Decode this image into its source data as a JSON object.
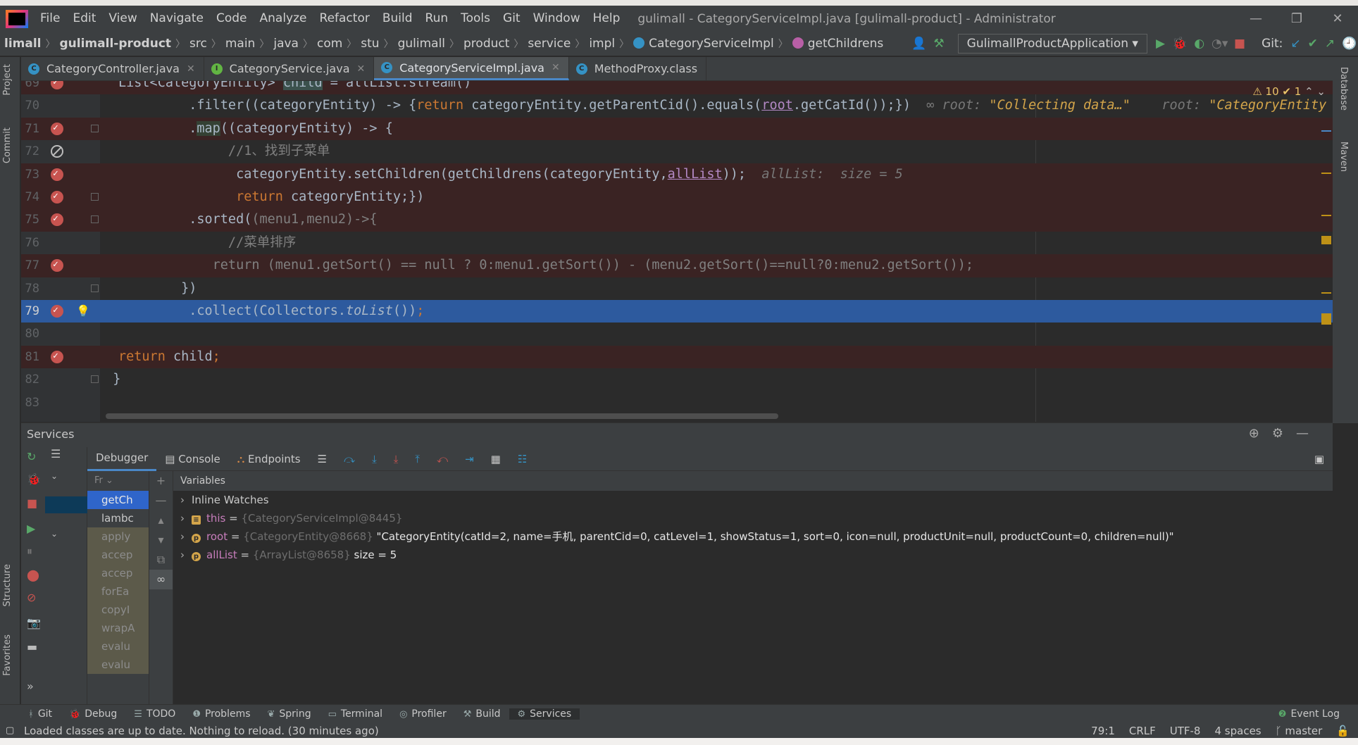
{
  "window": {
    "title": "gulimall - CategoryServiceImpl.java [gulimall-product] - Administrator",
    "menu": [
      "File",
      "Edit",
      "View",
      "Navigate",
      "Code",
      "Analyze",
      "Refactor",
      "Build",
      "Run",
      "Tools",
      "Git",
      "Window",
      "Help"
    ]
  },
  "breadcrumb": [
    "limall",
    "gulimall-product",
    "src",
    "main",
    "java",
    "com",
    "stu",
    "gulimall",
    "product",
    "service",
    "impl",
    "CategoryServiceImpl",
    "getChildrens"
  ],
  "run_config": "GulimallProductApplication",
  "git_label": "Git:",
  "tabs": [
    {
      "label": "CategoryController.java",
      "active": false,
      "color": "#3592c4",
      "letter": "C"
    },
    {
      "label": "CategoryService.java",
      "active": false,
      "color": "#62b543",
      "letter": "I"
    },
    {
      "label": "CategoryServiceImpl.java",
      "active": true,
      "color": "#3592c4",
      "letter": "C"
    },
    {
      "label": "MethodProxy.class",
      "active": false,
      "color": "#3592c4",
      "letter": "C"
    }
  ],
  "editor": {
    "warnings": "⚠ 10  ✔ 1",
    "lines": [
      {
        "n": "69",
        "text": "List<CategoryEntity> child = allList.stream()",
        "bp": true
      },
      {
        "n": "70",
        "text": "        .filter((categoryEntity) -> {return categoryEntity.getParentCid().equals(root.getCatId());})",
        "bp": false
      },
      {
        "n": "71",
        "text": "        .map((categoryEntity) -> {",
        "bp": true
      },
      {
        "n": "72",
        "text": "            //1、找到子菜单",
        "bp": false,
        "mute": true
      },
      {
        "n": "73",
        "text": "             categoryEntity.setChildren(getChildrens(categoryEntity,allList));",
        "bp": true
      },
      {
        "n": "74",
        "text": "             return categoryEntity;})",
        "bp": true
      },
      {
        "n": "75",
        "text": "        .sorted((menu1,menu2)->{",
        "bp": true
      },
      {
        "n": "76",
        "text": "            //菜单排序",
        "bp": false
      },
      {
        "n": "77",
        "text": "            return (menu1.getSort() == null ? 0:menu1.getSort()) - (menu2.getSort()==null?0:menu2.getSort());",
        "bp": true
      },
      {
        "n": "78",
        "text": "        })",
        "bp": false
      },
      {
        "n": "79",
        "text": "        .collect(Collectors.toList());",
        "bp": true,
        "selected": true
      },
      {
        "n": "80",
        "text": "",
        "bp": false
      },
      {
        "n": "81",
        "text": "return child;",
        "bp": true
      },
      {
        "n": "82",
        "text": "}",
        "bp": false
      },
      {
        "n": "83",
        "text": "",
        "bp": false
      }
    ],
    "hint_70": "root: \"Collecting data…\"    root: \"CategoryEntity",
    "hint_73": "allList:  size = 5"
  },
  "services": {
    "title": "Services",
    "debug_tabs": [
      "Debugger",
      "Console",
      "Endpoints"
    ],
    "frames_header": "Fr",
    "frames": [
      "getCh",
      "lambc",
      "apply",
      "accep",
      "accep",
      "forEa",
      "copyI",
      "wrapA",
      "evalu",
      "evalu"
    ],
    "variables_header": "Variables",
    "variables": [
      {
        "name": "Inline Watches",
        "type": "",
        "value": "",
        "kind": "watch"
      },
      {
        "name": "this",
        "type": "{CategoryServiceImpl@8445}",
        "value": "",
        "kind": "this"
      },
      {
        "name": "root",
        "type": "{CategoryEntity@8668}",
        "value": "\"CategoryEntity(catId=2, name=手机, parentCid=0, catLevel=1, showStatus=1, sort=0, icon=null, productUnit=null, productCount=0, children=null)\"",
        "kind": "p"
      },
      {
        "name": "allList",
        "type": "{ArrayList@8658}",
        "value": "size = 5",
        "kind": "p"
      }
    ]
  },
  "bottom_tabs": [
    "Git",
    "Debug",
    "TODO",
    "Problems",
    "Spring",
    "Terminal",
    "Profiler",
    "Build",
    "Services"
  ],
  "event_log": "Event Log",
  "status": {
    "message": "Loaded classes are up to date. Nothing to reload. (30 minutes ago)",
    "position": "79:1",
    "line_sep": "CRLF",
    "encoding": "UTF-8",
    "indent": "4 spaces",
    "branch": "master"
  },
  "side_labels": {
    "project": "Project",
    "commit": "Commit",
    "structure": "Structure",
    "favorites": "Favorites",
    "database": "Database",
    "maven": "Maven"
  }
}
